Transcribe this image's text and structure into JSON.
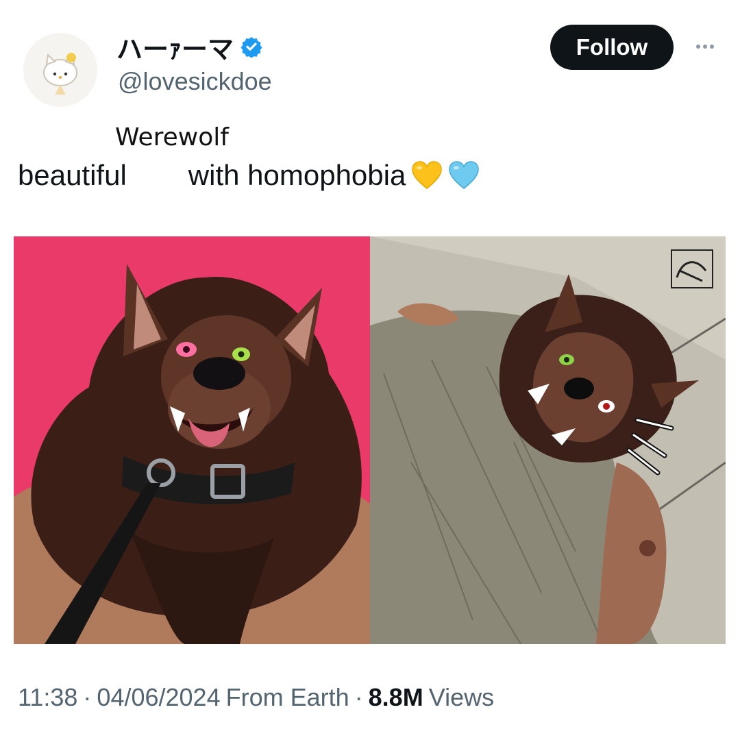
{
  "author": {
    "display_name": "ハーｧーマ",
    "handle": "@lovesickdoe",
    "verified": true,
    "avatar_icon": "hello-kitty-avatar"
  },
  "actions": {
    "follow_label": "Follow",
    "more_icon": "more-dots-icon"
  },
  "overlay_text": "Werewolf",
  "tweet": {
    "text_before": "beautiful",
    "text_after": "with homophobia",
    "emojis": [
      "yellow-heart",
      "light-blue-heart"
    ]
  },
  "media": {
    "left_image": "werewolf-with-collar-illustration",
    "right_image": "werewolf-under-blanket-illustration",
    "watermark": "artist-signature"
  },
  "meta": {
    "time": "11:38",
    "date": "04/06/2024",
    "source": "From Earth",
    "sep": "·",
    "views_count": "8.8M",
    "views_label": "Views"
  },
  "colors": {
    "left_bg": "#ea3a6a",
    "follow_bg": "#0f1419",
    "verified": "#1d9bf0",
    "secondary_text": "#536471"
  }
}
